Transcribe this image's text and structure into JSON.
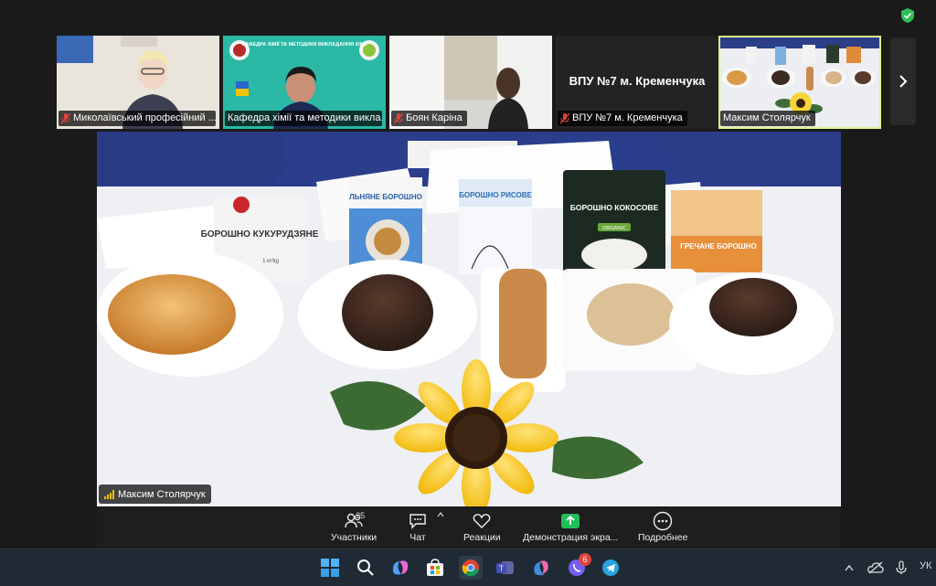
{
  "participants": [
    {
      "name": "Миколаївський професійний ...",
      "muted": true
    },
    {
      "name": "Кафедра хімії та методики викла...",
      "muted": false,
      "slide_title": "КАФЕДРА ХІМІЇ ТА МЕТОДИКИ ВИКЛАДАННЯ ХІМІЇ"
    },
    {
      "name": "Боян Каріна",
      "muted": true
    },
    {
      "name": "ВПУ №7 м. Кременчука",
      "muted": true,
      "display_text": "ВПУ №7 м. Кременчука"
    },
    {
      "name": "Максим Столярчук",
      "muted": false,
      "active": true
    }
  ],
  "active_speaker": {
    "name": "Максим Столярчук"
  },
  "products": {
    "corn": "БОРОШНО КУКУРУДЗЯНЕ",
    "corn_weight": "1 кг/kg",
    "flax": "ЛЬНЯНЕ БОРОШНО",
    "rice": "БОРОШНО РИСОВЕ",
    "coconut": "БОРОШНО КОКОСОВЕ",
    "coconut_tag": "ORGANIC",
    "buckwheat": "ГРЕЧАНЕ БОРОШНО"
  },
  "toolbar": {
    "participants_label": "Участники",
    "participants_count": "25",
    "chat_label": "Чат",
    "reactions_label": "Реакции",
    "share_label": "Демонстрация экра...",
    "more_label": "Подробнее"
  },
  "taskbar": {
    "viber_badge": "6",
    "tray_lang": "УК"
  },
  "colors": {
    "active_outline": "#d9f78a",
    "share_green": "#1fbf5a",
    "muted_red": "#e0443d"
  }
}
